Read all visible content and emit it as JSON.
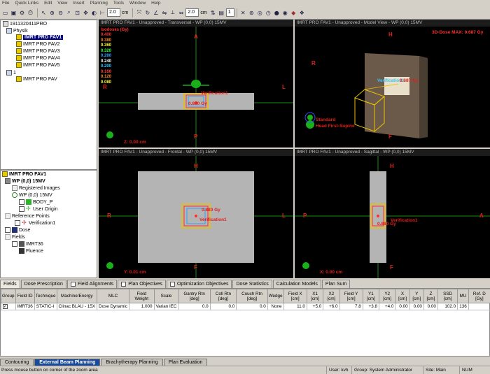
{
  "menu": [
    "File",
    "Quick Links",
    "Edit",
    "View",
    "Insert",
    "Planning",
    "Tools",
    "Window",
    "Help"
  ],
  "toolbar": {
    "zoom_value": "2.0",
    "zoom_unit": "cm",
    "step_value": "2.0",
    "step_unit": "cm",
    "slice_value": "1"
  },
  "plan_tree": {
    "root": "1911320411PRO",
    "group": "Physik",
    "items": [
      "IMRT PRO FAV1",
      "IMRT PRO FAV2",
      "IMRT PRO FAV3",
      "IMRT PRO FAV4",
      "IMRT PRO FAV5"
    ],
    "group2": "1",
    "item2": "IMRT PRO FAV"
  },
  "structure_tree": {
    "plan": "IMRT PRO FAV1",
    "image": "WP (0,0) 15MV",
    "registered": "Registered Images",
    "image2": "WP (0,0) 15MV",
    "body": "BODY_P",
    "user_origin": "User Origin",
    "ref_points": "Reference Points",
    "verification": "Verification1",
    "dose": "Dose",
    "fields": "Fields",
    "field": "IMRT36",
    "fluence": "Fluence"
  },
  "views": {
    "transversal": {
      "title": "IMRT PRO FAV1 - Unapproved - Transversal - WP (0,0) 15MV",
      "coord": "Z: 0.00 cm",
      "top": "A",
      "bottom": "P",
      "left": "R",
      "right": "L",
      "dose_label": "0.880 Gy",
      "point_label": "Verification1"
    },
    "model": {
      "title": "IMRT PRO FAV1 - Unapproved - Model View - WP (0,0) 15MV",
      "max": "3D-Dose MAX: 0.687 Gy",
      "top": "H",
      "bottom": "F",
      "left": "R",
      "label1": "Standard",
      "label2": "Head First-Supine",
      "point_label": "Verification1",
      "dose_label": "0.687 Gy"
    },
    "frontal": {
      "title": "IMRT PRO FAV1 - Unapproved - Frontal - WP (0,0) 15MV",
      "coord": "Y: 0.01 cm",
      "top": "H",
      "bottom": "F",
      "left": "R",
      "right": "L",
      "dose_label": "0.880 Gy",
      "point_label": "Verification1"
    },
    "sagittal": {
      "title": "IMRT PRO FAV1 - Unapproved - Sagittal - WP (0,0) 15MV",
      "coord": "X: 0.00 cm",
      "top": "H",
      "bottom": "F",
      "left": "P",
      "right": "A",
      "dose_label": "0.880 Gy",
      "point_label": "Verification1"
    }
  },
  "isodoses": {
    "title": "Isodoses (Gy)",
    "levels": [
      {
        "value": "0.400",
        "color": "#ff3030"
      },
      {
        "value": "0.380",
        "color": "#ff8c1a"
      },
      {
        "value": "0.360",
        "color": "#ffff30"
      },
      {
        "value": "0.320",
        "color": "#30ff30"
      },
      {
        "value": "0.280",
        "color": "#30a0ff"
      },
      {
        "value": "0.240",
        "color": "#ffffff"
      },
      {
        "value": "0.200",
        "color": "#30c8ff"
      },
      {
        "value": "0.160",
        "color": "#ff4040"
      },
      {
        "value": "0.120",
        "color": "#ff8c1a"
      },
      {
        "value": "0.080",
        "color": "#ffff30"
      }
    ]
  },
  "tabs": [
    "Fields",
    "Dose Prescription",
    "Field Alignments",
    "Plan Objectives",
    "Optimization Objectives",
    "Dose Statistics",
    "Calculation Models",
    "Plan Sum"
  ],
  "table": {
    "headers": [
      "Group",
      "Field ID",
      "Technique",
      "Machine/Energy",
      "MLC",
      "Field Weight",
      "Scale",
      "Gantry Rtn [deg]",
      "Coll Rtn [deg]",
      "Couch Rtn [deg]",
      "Wedge",
      "Field X [cm]",
      "X1 [cm]",
      "X2 [cm]",
      "Field Y [cm]",
      "Y1 [cm]",
      "Y2 [cm]",
      "X [cm]",
      "Y [cm]",
      "Z [cm]",
      "SSD [cm]",
      "MU",
      "Ref. D [Gy]"
    ],
    "rows": [
      [
        "",
        "IMRT36",
        "STATIC-I",
        "Clinac BLAU - 15X",
        "Dose Dynamic",
        "1.000",
        "Varian IEC",
        "0.0",
        "0.0",
        "0.0",
        "None",
        "11.0",
        "+5.0",
        "+6.0",
        "7.8",
        "+3.8",
        "+4.0",
        "0.00",
        "0.00",
        "0.00",
        "102.0",
        "136",
        ""
      ]
    ]
  },
  "workspaces": [
    "Contouring",
    "External Beam Planning",
    "Brachytherapy Planning",
    "Plan Evaluation"
  ],
  "status": {
    "message": "Press mouse button on corner of the zoom area",
    "user": "User: kvh",
    "group": "Group: System Administrator",
    "site": "Site: Main",
    "num": "NUM"
  }
}
